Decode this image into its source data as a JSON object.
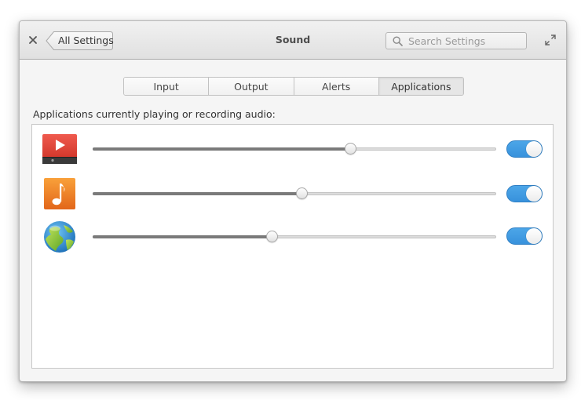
{
  "window": {
    "title": "Sound",
    "back_label": "All Settings",
    "search_placeholder": "Search Settings"
  },
  "tabs": [
    {
      "label": "Input",
      "active": false
    },
    {
      "label": "Output",
      "active": false
    },
    {
      "label": "Alerts",
      "active": false
    },
    {
      "label": "Applications",
      "active": true
    }
  ],
  "applications": {
    "description": "Applications currently playing or recording audio:",
    "items": [
      {
        "icon": "video-player-icon",
        "volume": 0.64,
        "enabled": true
      },
      {
        "icon": "music-player-icon",
        "volume": 0.52,
        "enabled": true
      },
      {
        "icon": "web-browser-icon",
        "volume": 0.445,
        "enabled": true
      }
    ]
  },
  "colors": {
    "toggle_on": "#3d97e0",
    "slider_fill": "#7a7a7a"
  }
}
